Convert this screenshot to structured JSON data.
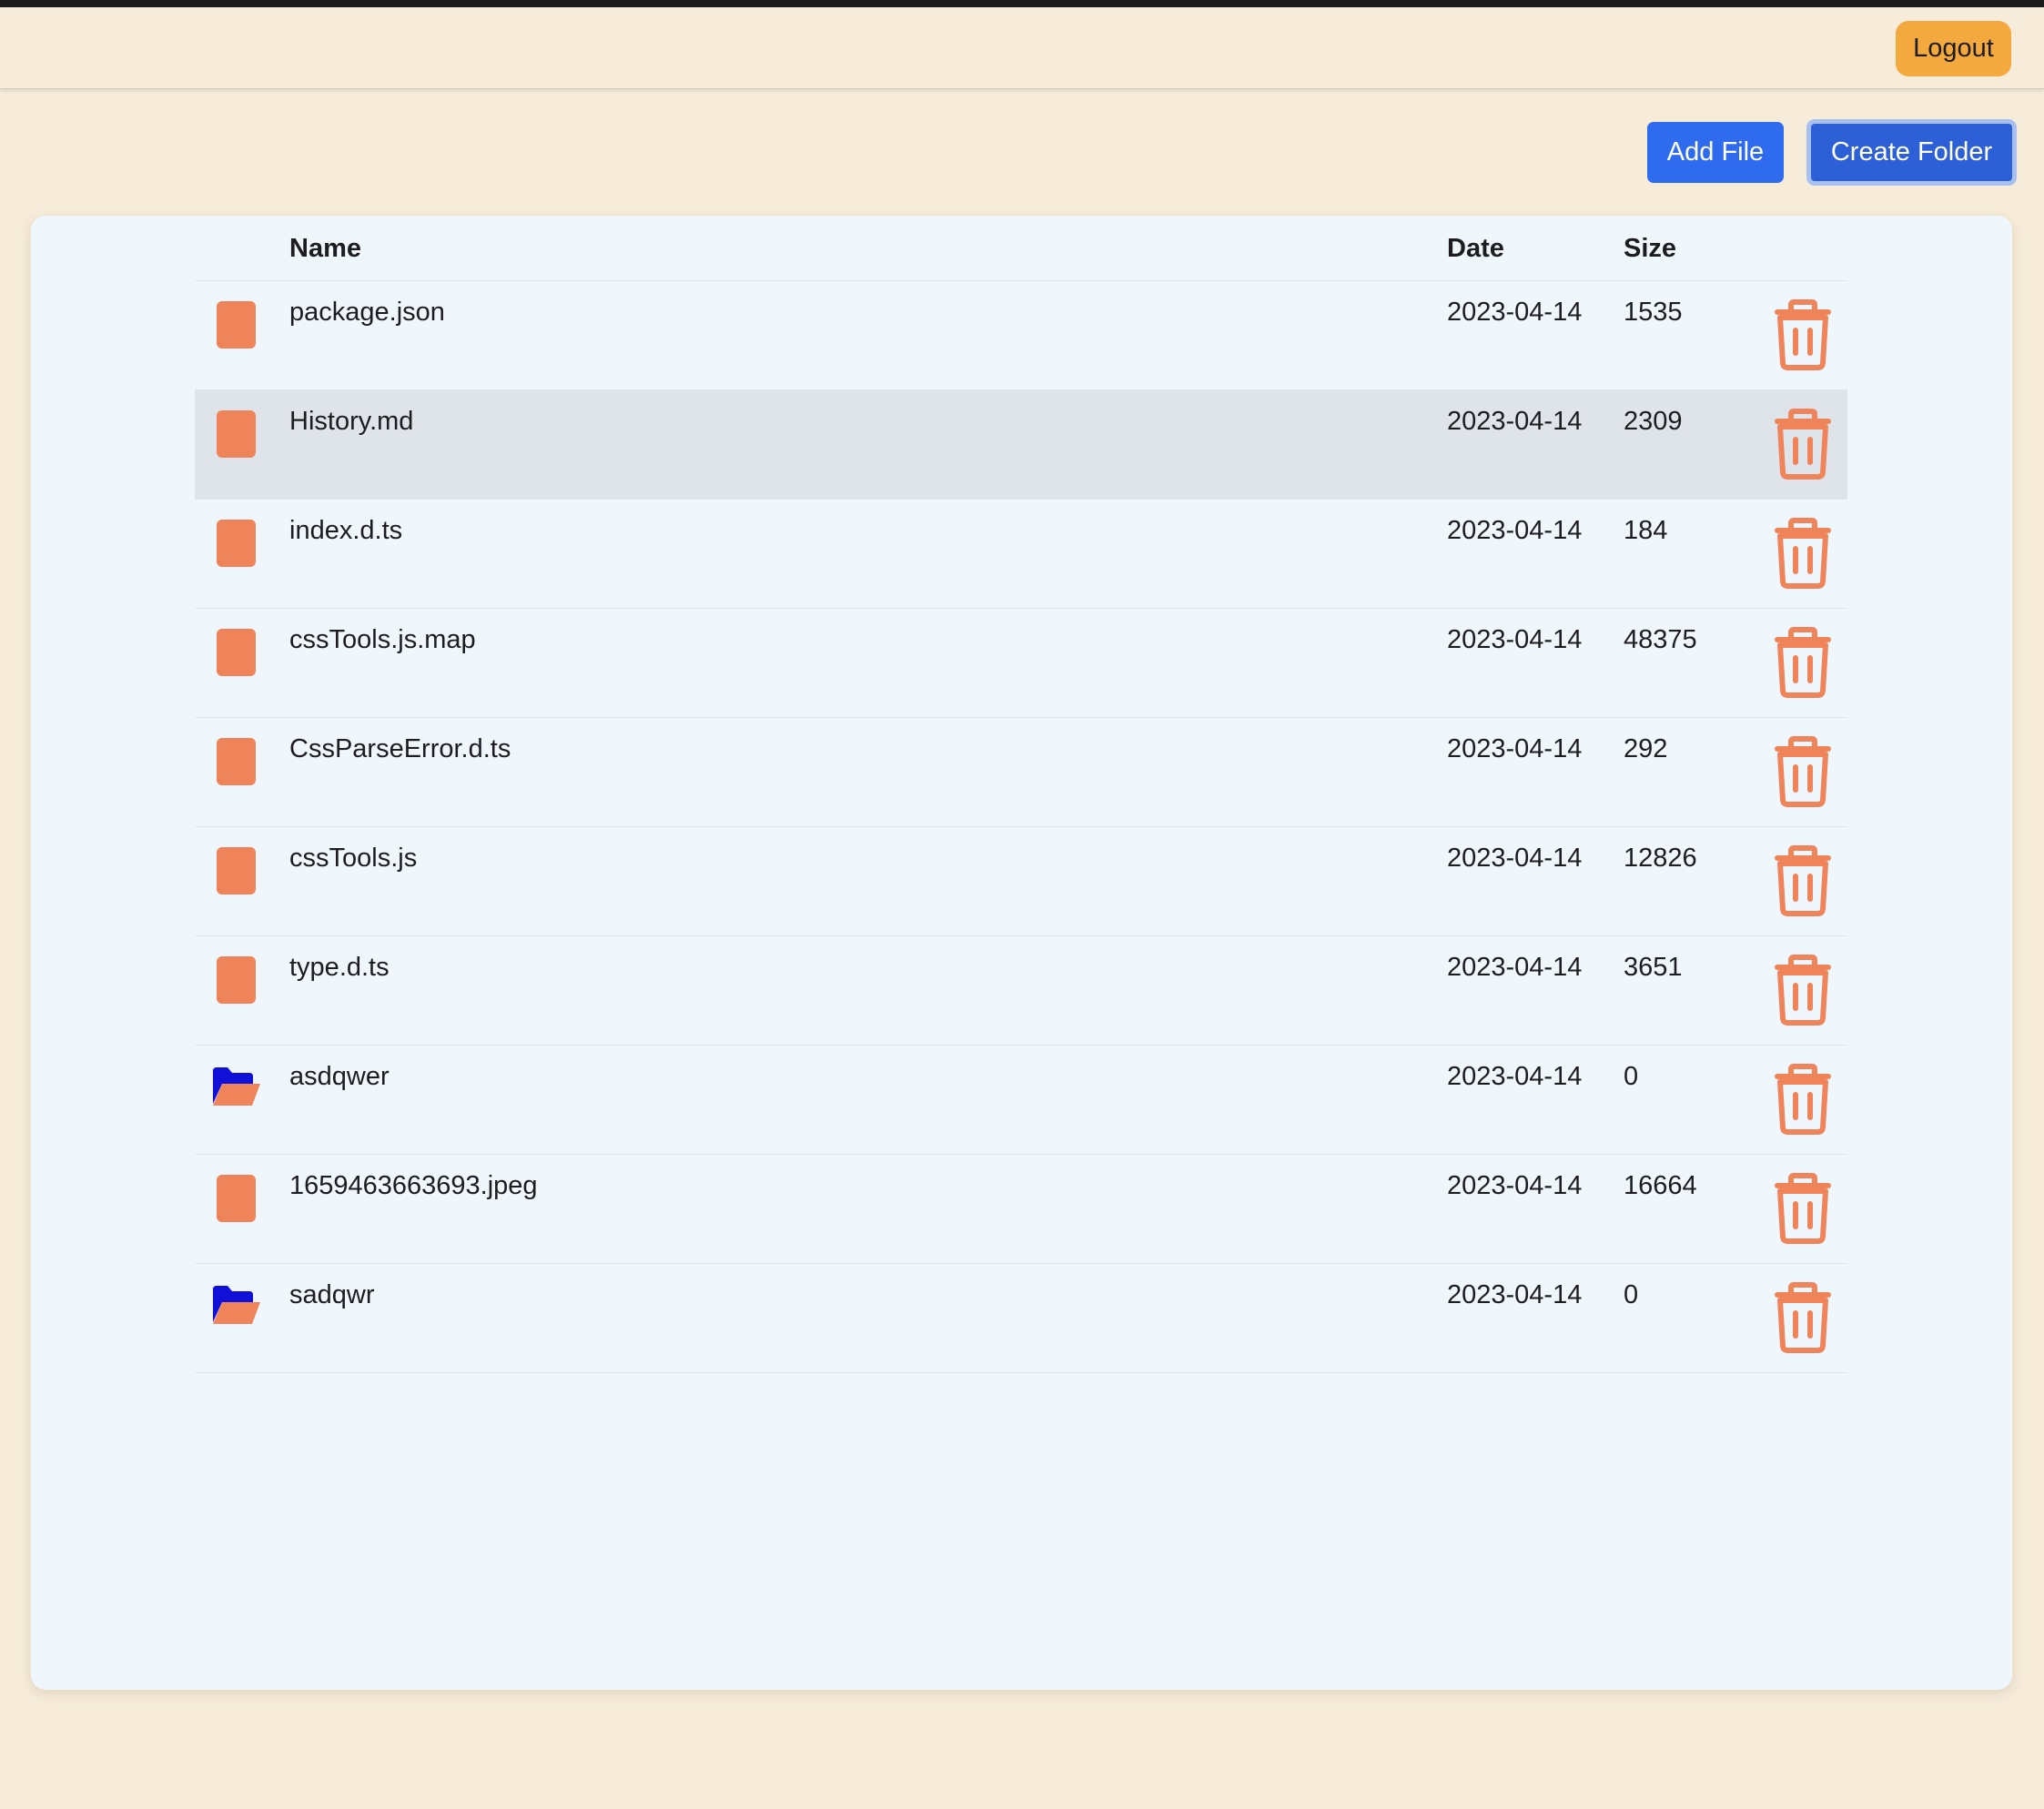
{
  "colors": {
    "background": "#f7ecda",
    "panel": "#eff6fc",
    "accent_orange": "#ef845b",
    "logout_bg": "#f3a93e",
    "primary_blue": "#2f6bef",
    "folder_blue": "#1010d8"
  },
  "navbar": {
    "logout_label": "Logout"
  },
  "toolbar": {
    "add_file_label": "Add File",
    "create_folder_label": "Create Folder"
  },
  "table": {
    "columns": {
      "name": "Name",
      "date": "Date",
      "size": "Size"
    },
    "rows": [
      {
        "type": "file",
        "icon": "file-icon",
        "name": "package.json",
        "date": "2023-04-14",
        "size": "1535",
        "highlighted": false
      },
      {
        "type": "file",
        "icon": "file-icon",
        "name": "History.md",
        "date": "2023-04-14",
        "size": "2309",
        "highlighted": true
      },
      {
        "type": "file",
        "icon": "file-icon",
        "name": "index.d.ts",
        "date": "2023-04-14",
        "size": "184",
        "highlighted": false
      },
      {
        "type": "file",
        "icon": "file-icon",
        "name": "cssTools.js.map",
        "date": "2023-04-14",
        "size": "48375",
        "highlighted": false
      },
      {
        "type": "file",
        "icon": "file-icon",
        "name": "CssParseError.d.ts",
        "date": "2023-04-14",
        "size": "292",
        "highlighted": false
      },
      {
        "type": "file",
        "icon": "file-icon",
        "name": "cssTools.js",
        "date": "2023-04-14",
        "size": "12826",
        "highlighted": false
      },
      {
        "type": "file",
        "icon": "file-icon",
        "name": "type.d.ts",
        "date": "2023-04-14",
        "size": "3651",
        "highlighted": false
      },
      {
        "type": "folder",
        "icon": "folder-open-icon",
        "name": "asdqwer",
        "date": "2023-04-14",
        "size": "0",
        "highlighted": false
      },
      {
        "type": "file",
        "icon": "file-icon",
        "name": "1659463663693.jpeg",
        "date": "2023-04-14",
        "size": "16664",
        "highlighted": false
      },
      {
        "type": "folder",
        "icon": "folder-open-icon",
        "name": "sadqwr",
        "date": "2023-04-14",
        "size": "0",
        "highlighted": false
      }
    ]
  }
}
